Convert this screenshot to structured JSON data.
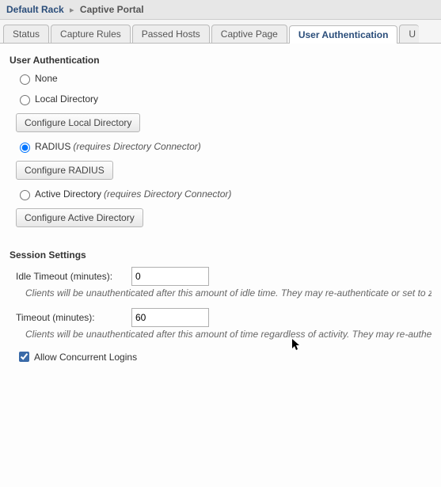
{
  "breadcrumb": {
    "item1": "Default Rack",
    "sep": "▸",
    "item2": "Captive Portal"
  },
  "tabs": {
    "t0": "Status",
    "t1": "Capture Rules",
    "t2": "Passed Hosts",
    "t3": "Captive Page",
    "t4": "User Authentication",
    "t5": "U"
  },
  "auth": {
    "title": "User Authentication",
    "none_label": "None",
    "local_label": "Local Directory",
    "configure_local_btn": "Configure Local Directory",
    "radius_label": "RADIUS",
    "radius_hint": "(requires Directory Connector)",
    "configure_radius_btn": "Configure RADIUS",
    "ad_label": "Active Directory",
    "ad_hint": "(requires Directory Connector)",
    "configure_ad_btn": "Configure Active Directory"
  },
  "session": {
    "title": "Session Settings",
    "idle_label": "Idle Timeout (minutes):",
    "idle_value": "0",
    "idle_help": "Clients will be unauthenticated after this amount of idle time. They may re-authenticate or set to zero to disable.",
    "timeout_label": "Timeout (minutes):",
    "timeout_value": "60",
    "timeout_help": "Clients will be unauthenticated after this amount of time regardless of activity. They may re-authenticate.",
    "allow_concurrent_label": "Allow Concurrent Logins"
  }
}
